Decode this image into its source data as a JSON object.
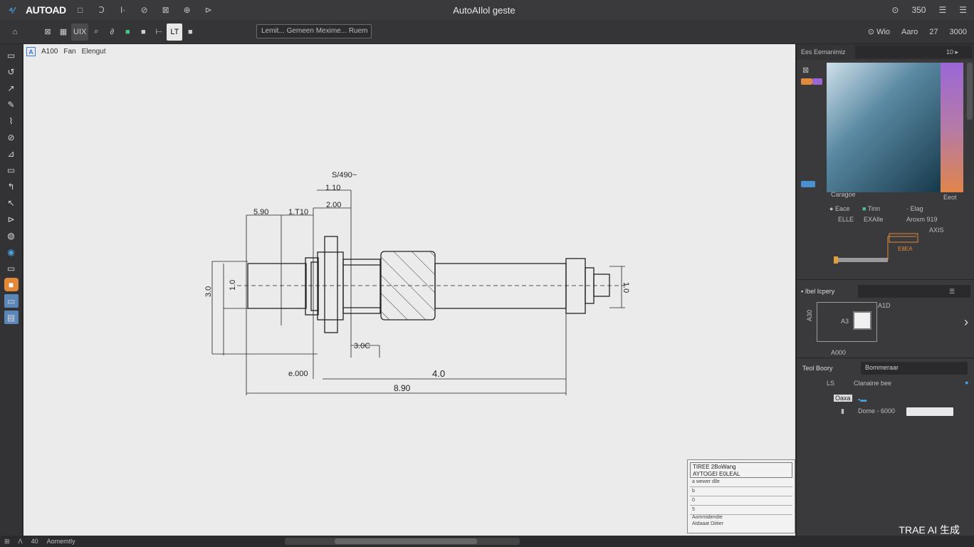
{
  "app": {
    "brand": "AUTOAD",
    "window_title": "AutoAIlol geste",
    "quick_access": [
      "□",
      "Ↄ",
      "I·",
      "⊘",
      "⊠",
      "⊕",
      "⊳"
    ],
    "title_right": [
      "⊙",
      "350",
      "☰",
      "☰"
    ]
  },
  "toolbar": {
    "items": [
      "⌂",
      "⊠",
      "▦",
      "UIX",
      "⌕",
      "∂",
      "■",
      "■",
      "⊢",
      "LT",
      "■"
    ],
    "command_text": "Lemit... Gemeen Mexime... Ruem",
    "right": [
      "⊙ Wio",
      "Aaro",
      "27",
      "3000"
    ]
  },
  "left_tools": [
    "▭",
    "↺",
    "↗",
    "✎",
    "⌇",
    "⊘",
    "⊿",
    "▭",
    "↰",
    "↖",
    "⊳",
    "◍",
    "◉",
    "▭",
    "■",
    "▭",
    "▤"
  ],
  "canvas": {
    "tab_icon": "A",
    "tab_labels": [
      "A100",
      "Fan",
      "Elengut"
    ],
    "dims": {
      "top_note": "S/490~",
      "d1": "1.10",
      "d2": "5.90",
      "d3": "1.T10",
      "d4": "2.00",
      "left_h": "3.0",
      "left_h2": "1.0",
      "right_h": "1.0",
      "callout": "3.0C",
      "bot_left": "e.000",
      "bot_mid": "4.0",
      "bot_total": "8.90"
    },
    "title_block": {
      "head_line1": "TIREE 2BoWang",
      "head_line2": "AYTOGEI E0LEAL",
      "rows": [
        "a wewer dlle",
        "b",
        "0",
        "5",
        "Aommidendie",
        "Atdaaat Diitier"
      ]
    }
  },
  "right_panel": {
    "header": "Ees Eemanimiz",
    "header_right": "10 ▸",
    "color_label_left": "Caragoe",
    "color_label_right": "Eeot",
    "radio_items": [
      "Eace",
      "Tinn",
      "Elag"
    ],
    "sub_items": [
      "ELLE",
      "EXAIle",
      "Aroxm 919"
    ],
    "side_note": "AXIS",
    "mini_label": "E8EA",
    "section2_title": "Ibel Icpery",
    "preview_side": "A30",
    "preview_label": "A3",
    "preview_top": "A1D",
    "preview_bottom": "A000",
    "section3_title": "Teol Boory",
    "section3_field": "Bommeraar",
    "section3_sub_left": "LS",
    "section3_sub_right": "Clanaine bee",
    "tree_item1": "Oaxa",
    "tree_item2": "Dome - 6000"
  },
  "status": {
    "items": [
      "⊞",
      "Ʌ",
      "40",
      "Aomemtly"
    ]
  },
  "watermark": "TRAE AI 生成",
  "colors": {
    "accent_blue": "#4aa3e0",
    "orange": "#e0893a",
    "green": "#4cc08c",
    "purple": "#9b67d6"
  }
}
